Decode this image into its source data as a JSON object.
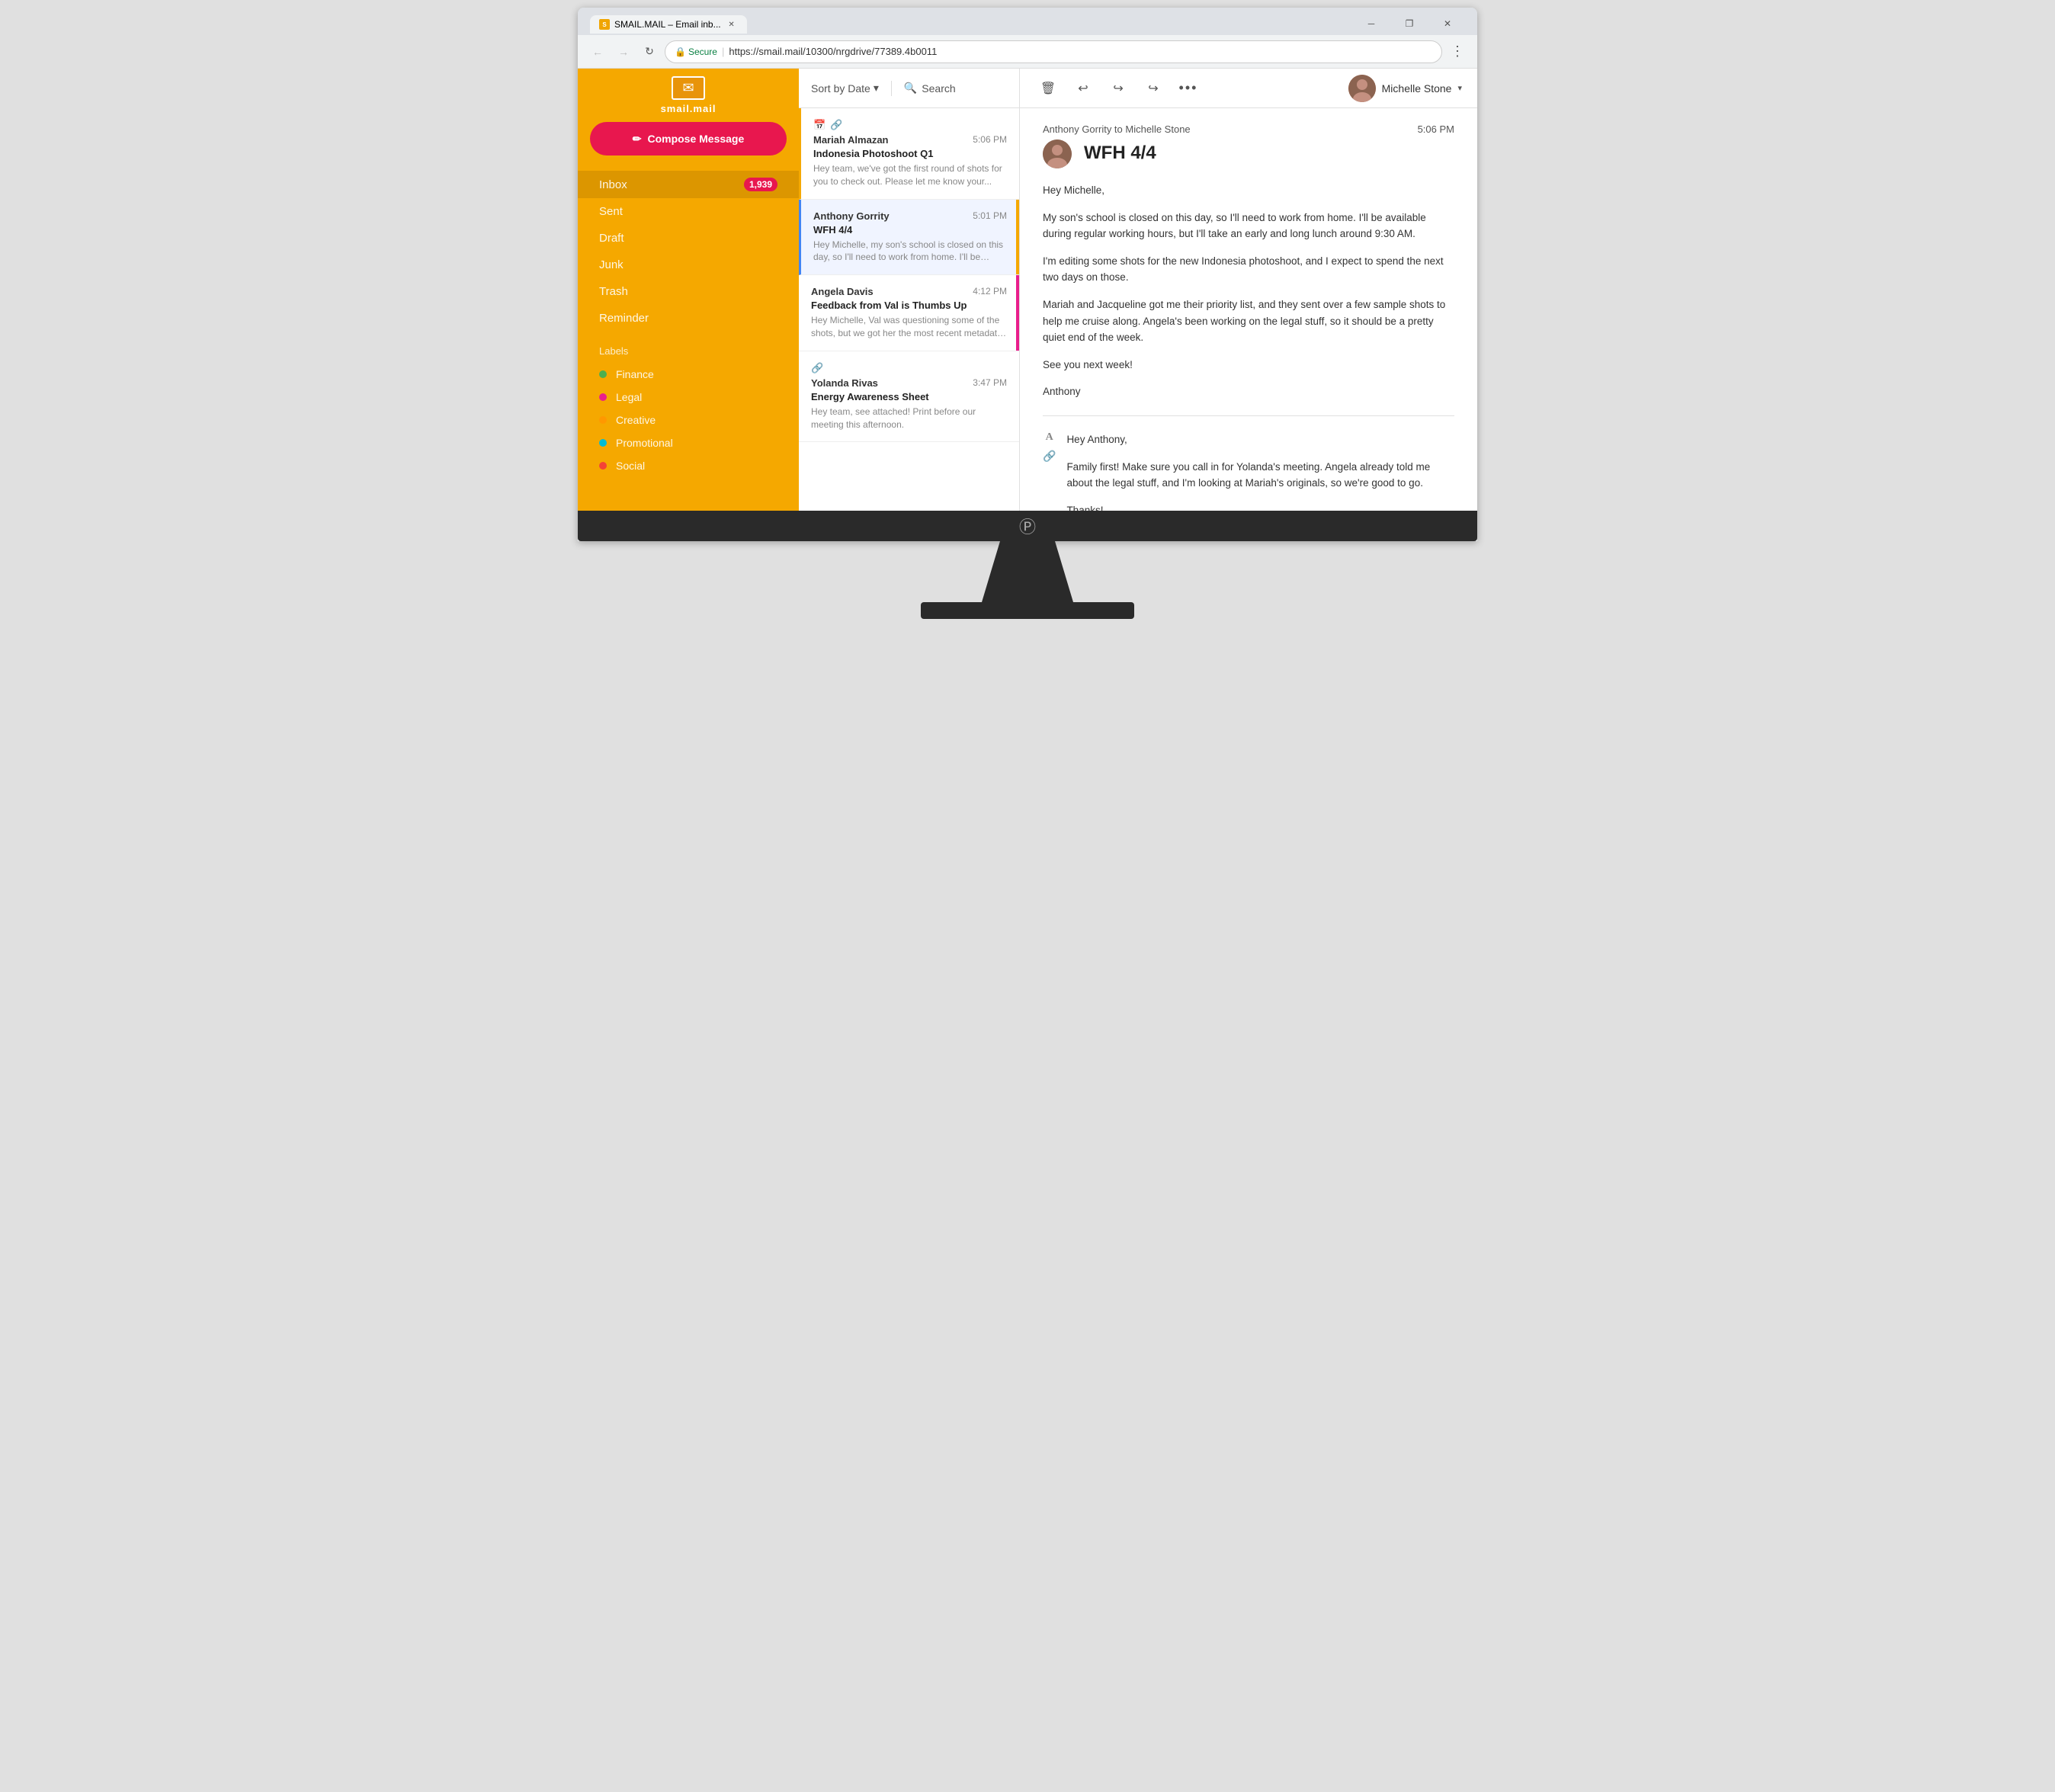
{
  "browser": {
    "tab_title": "SMAIL.MAIL – Email inb...",
    "url_secure": "Secure",
    "url": "https://smail.mail/10300/nrgdrive/77389.4b0011"
  },
  "app": {
    "logo_text": "smail.mail",
    "compose_label": "Compose Message"
  },
  "sidebar": {
    "nav_items": [
      {
        "label": "Inbox",
        "badge": "1,939"
      },
      {
        "label": "Sent",
        "badge": ""
      },
      {
        "label": "Draft",
        "badge": ""
      },
      {
        "label": "Junk",
        "badge": ""
      },
      {
        "label": "Trash",
        "badge": ""
      },
      {
        "label": "Reminder",
        "badge": ""
      }
    ],
    "labels_title": "Labels",
    "labels": [
      {
        "name": "Finance",
        "color": "#4caf50"
      },
      {
        "name": "Legal",
        "color": "#e91e8c"
      },
      {
        "name": "Creative",
        "color": "#ff9800"
      },
      {
        "name": "Promotional",
        "color": "#00bcd4"
      },
      {
        "name": "Social",
        "color": "#f44336"
      }
    ]
  },
  "email_list": {
    "sort_label": "Sort by Date",
    "search_label": "Search",
    "emails": [
      {
        "sender": "Mariah Almazan",
        "subject": "Indonesia Photoshoot Q1",
        "time": "5:06 PM",
        "preview": "Hey team, we've got the first round of shots for you to check out. Please let me know your...",
        "has_calendar": true,
        "has_attachment": true,
        "priority_color": "#f5a800",
        "selected": false
      },
      {
        "sender": "Anthony Gorrity",
        "subject": "WFH 4/4",
        "time": "5:01 PM",
        "preview": "Hey Michelle, my son's school is closed on this day, so I'll need to work from home. I'll be available...",
        "has_calendar": false,
        "has_attachment": false,
        "priority_color": "#f5a800",
        "selected": true
      },
      {
        "sender": "Angela Davis",
        "subject": "Feedback from Val is Thumbs Up",
        "time": "4:12 PM",
        "preview": "Hey Michelle, Val was questioning some of the shots, but we got her the most recent metadata, and she said...",
        "has_calendar": false,
        "has_attachment": false,
        "priority_color": "#e91e8c",
        "selected": false
      },
      {
        "sender": "Yolanda Rivas",
        "subject": "Energy Awareness Sheet",
        "time": "3:47 PM",
        "preview": "Hey team, see attached! Print before our meeting this afternoon.",
        "has_calendar": false,
        "has_attachment": true,
        "priority_color": "",
        "selected": false
      }
    ]
  },
  "email_detail": {
    "from": "Anthony Gorrity",
    "to": "Michelle Stone",
    "from_to_label": "Anthony Gorrity to Michelle Stone",
    "time": "5:06 PM",
    "subject": "WFH 4/4",
    "body_paragraphs": [
      "Hey Michelle,",
      "My son's school is closed on this day, so I'll need to work from home. I'll be available during regular working hours, but I'll take an early and long lunch around 9:30 AM.",
      "I'm editing some shots for the new Indonesia photoshoot, and I expect to spend the next two days on those.",
      "Mariah and Jacqueline got me their priority list, and they sent over a few sample shots to help me cruise along. Angela's been working on the legal stuff, so it should be a pretty quiet end of the week.",
      "See you next week!",
      "Anthony"
    ],
    "reply_body": "Hey Anthony,\n\nFamily first! Make sure you call in for Yolanda's meeting. Angela already told me about the legal stuff, and I'm looking at Mariah's originals, so we're good to go.\n\nThanks!"
  },
  "toolbar": {
    "delete_icon": "🗑",
    "reply_back_icon": "↩",
    "reply_all_icon": "↩",
    "forward_icon": "↪",
    "more_icon": "···"
  },
  "user": {
    "name": "Michelle Stone"
  }
}
